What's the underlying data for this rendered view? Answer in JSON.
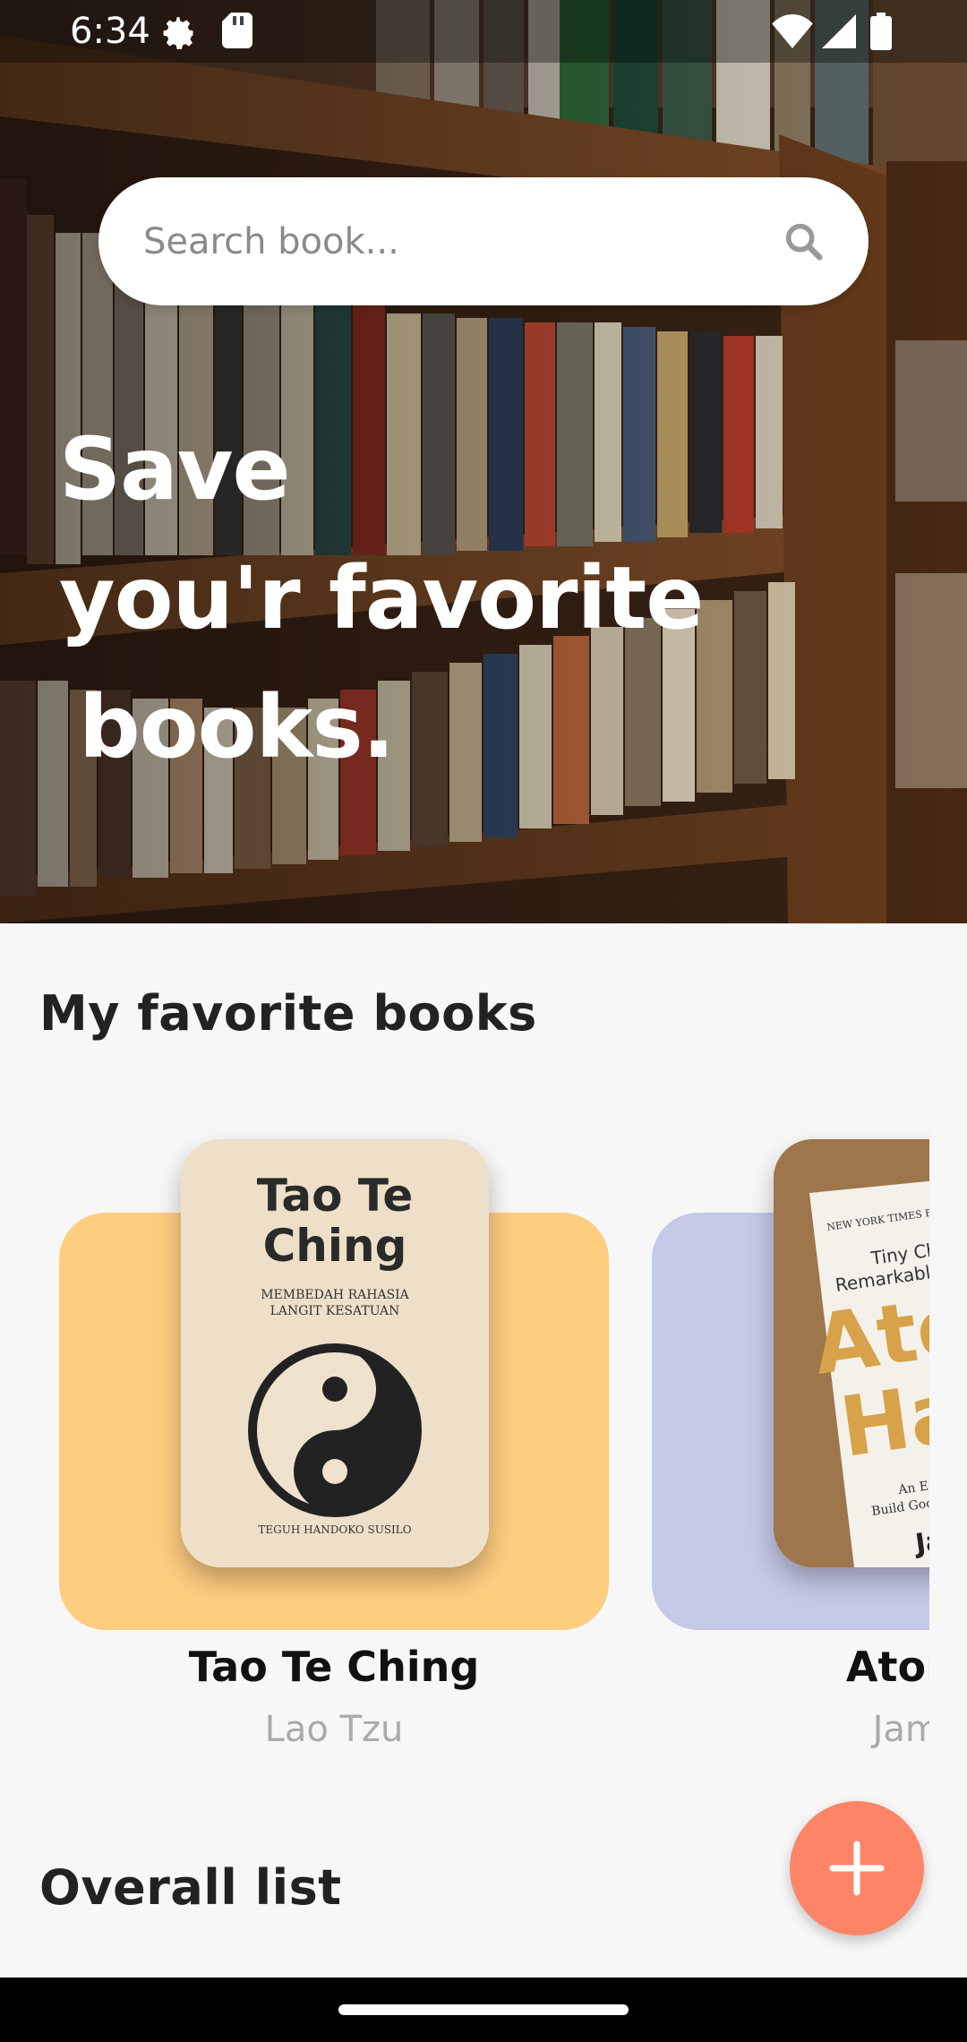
{
  "status_bar": {
    "time": "6:34",
    "left_icons": [
      "settings-icon",
      "sd-card-icon"
    ],
    "right_icons": [
      "wifi-icon",
      "signal-icon",
      "battery-icon"
    ]
  },
  "search": {
    "placeholder": "Search book...",
    "icon": "search-icon"
  },
  "hero": {
    "line1": "Save",
    "line2": "you'r favorite",
    "line3": "books."
  },
  "favorites": {
    "title": "My favorite books",
    "books": [
      {
        "title": "Tao Te Ching",
        "author": "Lao Tzu",
        "card_color": "#fecd80",
        "cover_title_line1": "Tao Te",
        "cover_title_line2": "Ching",
        "cover_subtitle_line1": "MEMBEDAH RAHASIA",
        "cover_subtitle_line2": "LANGIT KESATUAN",
        "cover_author": "TEGUH HANDOKO SUSILO"
      },
      {
        "title": "Atomic",
        "author": "James",
        "card_color": "#c5c8e6",
        "cover_banner": "NEW YORK TIMES BE",
        "cover_tag_line1": "Tiny Chang",
        "cover_tag_line2": "Remarkable W",
        "cover_big1": "Ato",
        "cover_big2": "Ha",
        "cover_small1": "An Easy",
        "cover_small2": "Build Good",
        "cover_author": "Ja"
      }
    ]
  },
  "overall": {
    "title": "Overall list"
  },
  "fab": {
    "icon": "plus-icon",
    "color": "#fd8466"
  }
}
